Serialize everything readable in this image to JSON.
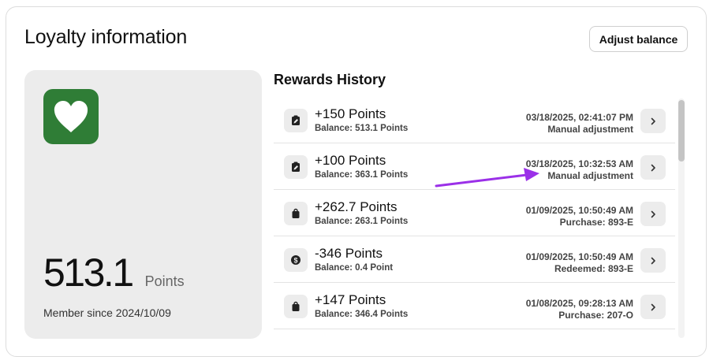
{
  "card": {
    "title": "Loyalty information",
    "adjust_button_label": "Adjust balance"
  },
  "points_panel": {
    "logo_icon": "heart-icon",
    "brand_color": "#2f7d36",
    "points_value": "513.1",
    "points_unit": "Points",
    "member_since": "Member since 2024/10/09"
  },
  "history": {
    "title": "Rewards History",
    "rows": [
      {
        "icon": "clipboard-edit-icon",
        "amount": "+150 Points",
        "balance": "Balance: 513.1 Points",
        "date": "03/18/2025, 02:41:07 PM",
        "note": "Manual adjustment"
      },
      {
        "icon": "clipboard-edit-icon",
        "amount": "+100 Points",
        "balance": "Balance: 363.1 Points",
        "date": "03/18/2025, 10:32:53 AM",
        "note": "Manual adjustment"
      },
      {
        "icon": "shopping-bag-icon",
        "amount": "+262.7 Points",
        "balance": "Balance: 263.1 Points",
        "date": "01/09/2025, 10:50:49 AM",
        "note": "Purchase: 893-E"
      },
      {
        "icon": "dollar-coin-icon",
        "amount": "-346 Points",
        "balance": "Balance: 0.4 Point",
        "date": "01/09/2025, 10:50:49 AM",
        "note": "Redeemed: 893-E"
      },
      {
        "icon": "shopping-bag-icon",
        "amount": "+147 Points",
        "balance": "Balance: 346.4 Points",
        "date": "01/08/2025, 09:28:13 AM",
        "note": "Purchase: 207-O"
      }
    ]
  },
  "annotation": {
    "arrow_color": "#9b30e8"
  }
}
